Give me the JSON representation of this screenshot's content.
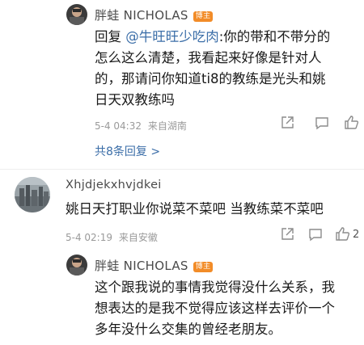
{
  "thread": {
    "reply1": {
      "author": "胖蛙 NICHOLAS",
      "badge": "博主",
      "prefix": "回复",
      "mention": "@牛旺旺少吃肉",
      "text_line1": ":你的带和不带分的",
      "text_line2": "怎么这么清楚，我看起来好像是针对人",
      "text_line3": "的，那请问你知道ti8的教练是光头和姚",
      "text_line4": "日天双教练吗",
      "date": "5-4 04:32",
      "location": "来自湖南",
      "total_replies_link": "共8条回复 >"
    },
    "comment2": {
      "author": "Xhjdjekxhvjdkei",
      "text": "姚日天打职业你说菜不菜吧 当教练菜不菜吧",
      "date": "5-4 02:19",
      "location": "来自安徽",
      "like_count": "2"
    },
    "reply2": {
      "author": "胖蛙 NICHOLAS",
      "badge": "博主",
      "text_line1": "这个跟我说的事情我觉得没什么关系，我",
      "text_line2": "想表达的是我不觉得应该这样去评价一个",
      "text_line3": "多年没什么交集的曾经老朋友。"
    }
  },
  "colors": {
    "link": "#3b6ea8",
    "badge": "#f28c28",
    "meta": "#9a9a9a"
  },
  "icons": [
    "share-icon",
    "comment-icon",
    "like-icon"
  ]
}
